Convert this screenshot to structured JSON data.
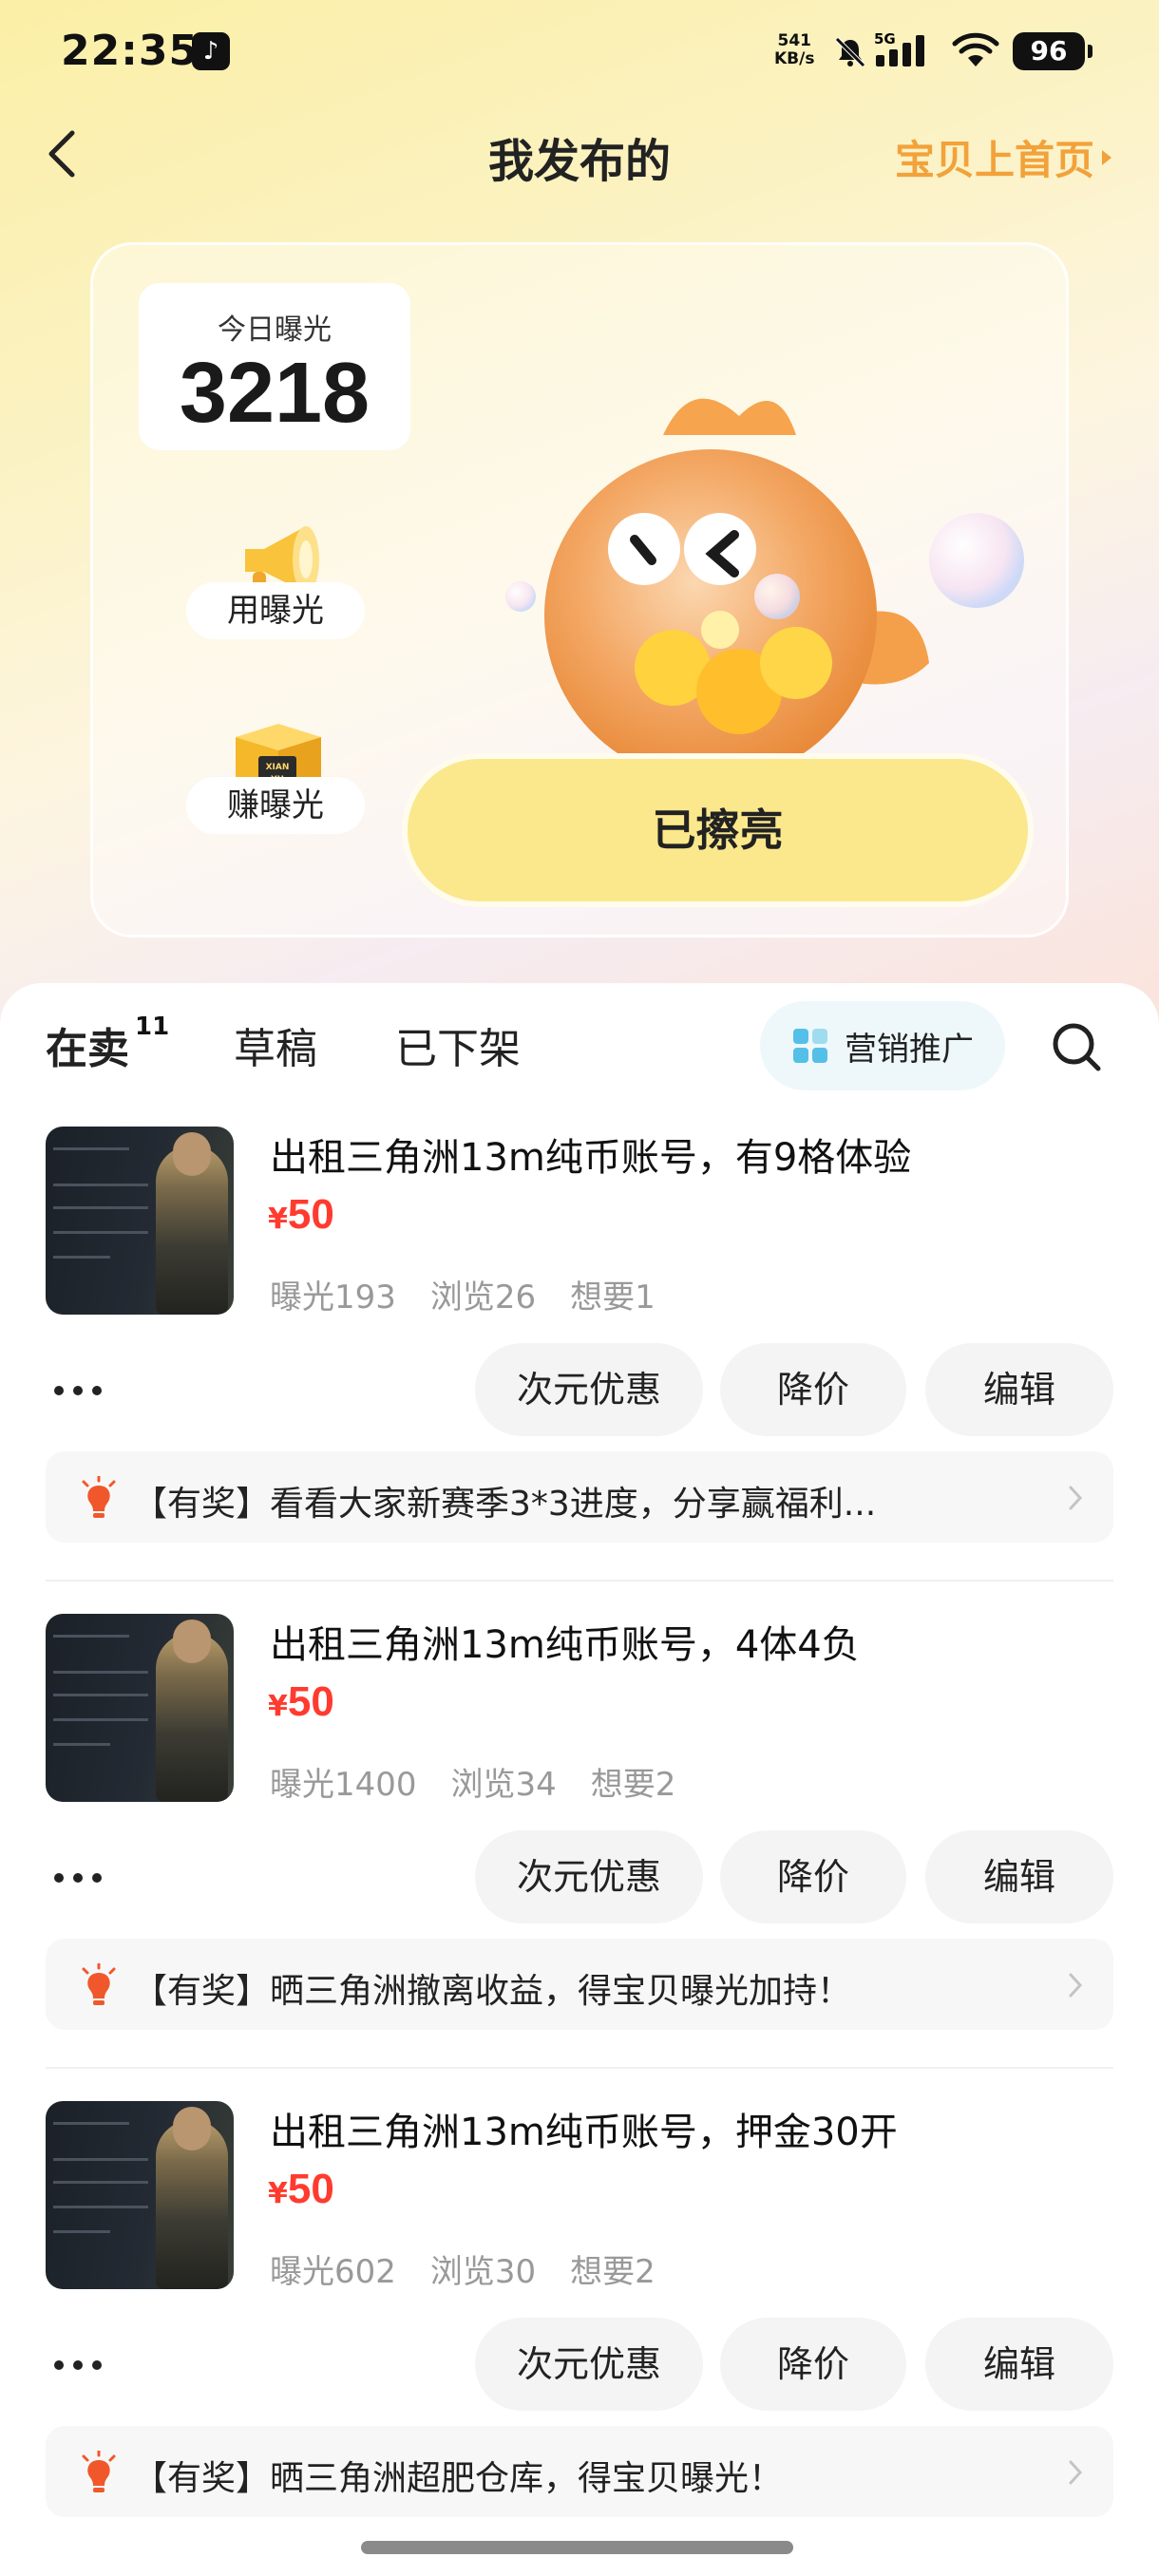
{
  "status_bar": {
    "time": "22:35",
    "net_speed_value": "541",
    "net_speed_unit": "KB/s",
    "network": "5G",
    "battery": "96"
  },
  "header": {
    "title": "我发布的",
    "promote_link": "宝贝上首页"
  },
  "exposure": {
    "today_label": "今日曝光",
    "today_value": "3218",
    "use_label": "用曝光",
    "earn_label": "赚曝光",
    "box_text": "XIAN YU",
    "shine_label": "已擦亮"
  },
  "tabs": [
    {
      "label": "在卖",
      "badge": "11",
      "active": true
    },
    {
      "label": "草稿",
      "active": false
    },
    {
      "label": "已下架",
      "active": false
    }
  ],
  "marketing_label": "营销推广",
  "listings": [
    {
      "title": "出租三角洲13m纯币账号，有9格体验",
      "currency": "¥",
      "price": "50",
      "stats": {
        "exposure": "曝光193",
        "views": "浏览26",
        "wants": "想要1"
      },
      "actions": {
        "discount": "次元优惠",
        "reduce": "降价",
        "edit": "编辑"
      },
      "banner": "【有奖】看看大家新赛季3*3进度，分享赢福利..."
    },
    {
      "title": "出租三角洲13m纯币账号，4体4负",
      "currency": "¥",
      "price": "50",
      "stats": {
        "exposure": "曝光1400",
        "views": "浏览34",
        "wants": "想要2"
      },
      "actions": {
        "discount": "次元优惠",
        "reduce": "降价",
        "edit": "编辑"
      },
      "banner": "【有奖】晒三角洲撤离收益，得宝贝曝光加持！"
    },
    {
      "title": "出租三角洲13m纯币账号，押金30开",
      "currency": "¥",
      "price": "50",
      "stats": {
        "exposure": "曝光602",
        "views": "浏览30",
        "wants": "想要2"
      },
      "actions": {
        "discount": "次元优惠",
        "reduce": "降价",
        "edit": "编辑"
      },
      "banner": "【有奖】晒三角洲超肥仓库，得宝贝曝光！"
    }
  ],
  "colors": {
    "accent_yellow": "#ffe23b",
    "price_red": "#ff3b30",
    "promote_orange": "#f2a23a",
    "bulb_red": "#f0582c"
  }
}
